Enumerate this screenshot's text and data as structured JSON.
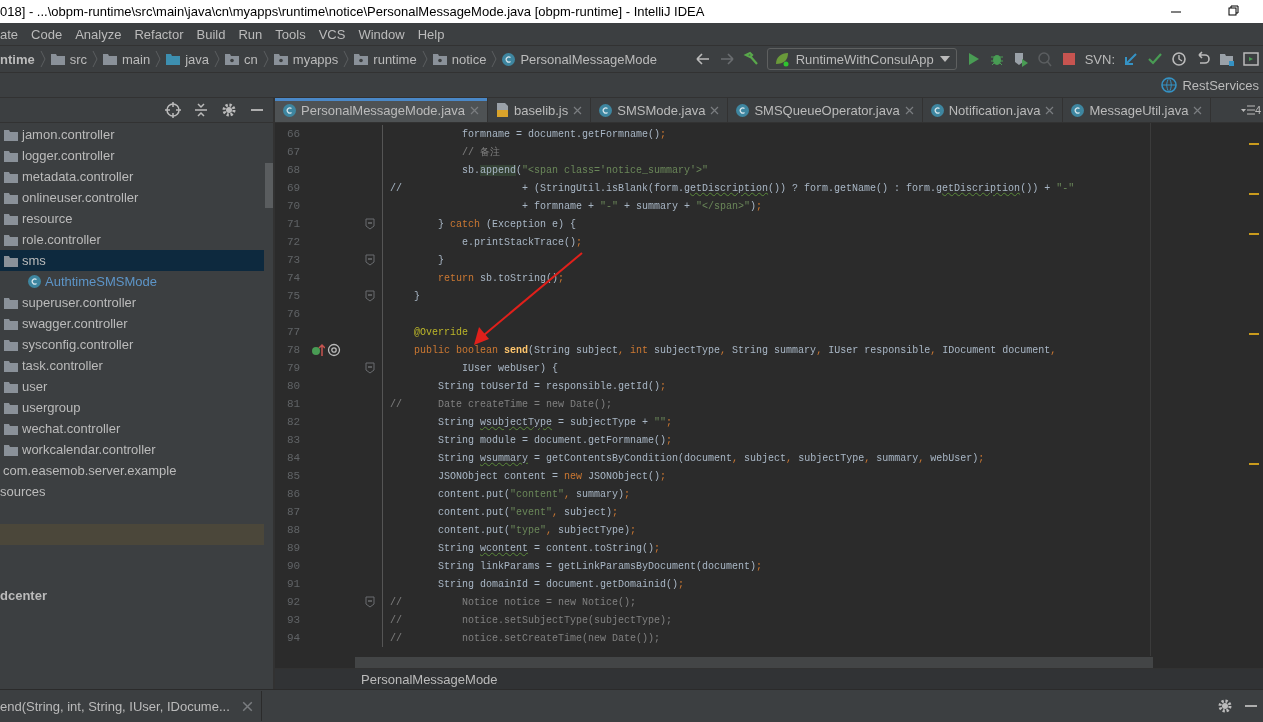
{
  "window": {
    "title": "018] - ...\\obpm-runtime\\src\\main\\java\\cn\\myapps\\runtime\\notice\\PersonalMessageMode.java [obpm-runtime] - IntelliJ IDEA"
  },
  "menu": [
    "ate",
    "Code",
    "Analyze",
    "Refactor",
    "Build",
    "Run",
    "Tools",
    "VCS",
    "Window",
    "Help"
  ],
  "breadcrumbs": [
    {
      "label": "ntime",
      "kind": "module"
    },
    {
      "label": "src",
      "kind": "folder"
    },
    {
      "label": "main",
      "kind": "folder"
    },
    {
      "label": "java",
      "kind": "source"
    },
    {
      "label": "cn",
      "kind": "package"
    },
    {
      "label": "myapps",
      "kind": "package"
    },
    {
      "label": "runtime",
      "kind": "package"
    },
    {
      "label": "notice",
      "kind": "package"
    },
    {
      "label": "PersonalMessageMode",
      "kind": "class"
    }
  ],
  "run_config": "RuntimeWithConsulApp",
  "svn_label": "SVN:",
  "rest_services": "RestServices",
  "tabs": [
    {
      "label": "PersonalMessageMode.java",
      "kind": "class",
      "selected": true
    },
    {
      "label": "baselib.js",
      "kind": "js",
      "selected": false
    },
    {
      "label": "SMSMode.java",
      "kind": "class",
      "selected": false
    },
    {
      "label": "SMSQueueOperator.java",
      "kind": "class",
      "selected": false
    },
    {
      "label": "Notification.java",
      "kind": "class",
      "selected": false
    },
    {
      "label": "MessageUtil.java",
      "kind": "class",
      "selected": false
    }
  ],
  "tabs_overflow": "4",
  "sidebar": {
    "items": [
      {
        "label": "jamon.controller",
        "kind": "folder",
        "selected": false
      },
      {
        "label": "logger.controller",
        "kind": "folder",
        "selected": false
      },
      {
        "label": "metadata.controller",
        "kind": "folder",
        "selected": false
      },
      {
        "label": "onlineuser.controller",
        "kind": "folder",
        "selected": false
      },
      {
        "label": "resource",
        "kind": "folder",
        "selected": false
      },
      {
        "label": "role.controller",
        "kind": "folder",
        "selected": false
      },
      {
        "label": "sms",
        "kind": "folder",
        "selected": true,
        "children": [
          {
            "label": "AuthtimeSMSMode",
            "kind": "class",
            "selected": false
          }
        ]
      },
      {
        "label": "superuser.controller",
        "kind": "folder",
        "selected": false
      },
      {
        "label": "swagger.controller",
        "kind": "folder",
        "selected": false
      },
      {
        "label": "sysconfig.controller",
        "kind": "folder",
        "selected": false
      },
      {
        "label": "task.controller",
        "kind": "folder",
        "selected": false
      },
      {
        "label": "user",
        "kind": "folder",
        "selected": false
      },
      {
        "label": "usergroup",
        "kind": "folder",
        "selected": false
      },
      {
        "label": "wechat.controller",
        "kind": "folder",
        "selected": false
      },
      {
        "label": "workcalendar.controller",
        "kind": "folder",
        "selected": false
      },
      {
        "label": "com.easemob.server.example",
        "kind": "package",
        "selected": false
      },
      {
        "label": "sources",
        "kind": "root",
        "selected": false
      }
    ],
    "bold_label": "dcenter"
  },
  "editor": {
    "lines": [
      {
        "n": "66",
        "fold": false,
        "tokens": [
          {
            "kind": "plain",
            "text": "            formname = document.getFormname()"
          },
          {
            "kind": "keyword",
            "text": ";"
          }
        ]
      },
      {
        "n": "67",
        "fold": false,
        "tokens": [
          {
            "kind": "comment",
            "text": "            // 备注"
          }
        ]
      },
      {
        "n": "68",
        "fold": false,
        "tokens": [
          {
            "kind": "plain",
            "text": "            sb."
          },
          {
            "kind": "highlight",
            "text": "append"
          },
          {
            "kind": "plain",
            "text": "("
          },
          {
            "kind": "string",
            "text": "\"<span class='notice_summary'>\""
          }
        ]
      },
      {
        "n": "69",
        "fold": false,
        "tokens": [
          {
            "kind": "plain",
            "text": "//                    + (StringUtil.isBlank(form."
          },
          {
            "kind": "warning",
            "text": "getDiscription"
          },
          {
            "kind": "plain",
            "text": "()) ? form.getName() : form."
          },
          {
            "kind": "warning",
            "text": "getDiscription"
          },
          {
            "kind": "plain",
            "text": "()) + "
          },
          {
            "kind": "string",
            "text": "\"-\""
          }
        ]
      },
      {
        "n": "70",
        "fold": false,
        "tokens": [
          {
            "kind": "plain",
            "text": "                      + formname + "
          },
          {
            "kind": "string",
            "text": "\"-\""
          },
          {
            "kind": "plain",
            "text": " + summary + "
          },
          {
            "kind": "string",
            "text": "\"</span>\""
          },
          {
            "kind": "plain",
            "text": ")"
          },
          {
            "kind": "keyword",
            "text": ";"
          }
        ]
      },
      {
        "n": "71",
        "fold": true,
        "tokens": [
          {
            "kind": "plain",
            "text": "        } "
          },
          {
            "kind": "keyword",
            "text": "catch"
          },
          {
            "kind": "plain",
            "text": " (Exception e) {"
          }
        ]
      },
      {
        "n": "72",
        "fold": false,
        "tokens": [
          {
            "kind": "plain",
            "text": "            e.printStackTrace()"
          },
          {
            "kind": "keyword",
            "text": ";"
          }
        ]
      },
      {
        "n": "73",
        "fold": true,
        "tokens": [
          {
            "kind": "plain",
            "text": "        }"
          }
        ]
      },
      {
        "n": "74",
        "fold": false,
        "tokens": [
          {
            "kind": "keyword",
            "text": "        return"
          },
          {
            "kind": "plain",
            "text": " sb.toString()"
          },
          {
            "kind": "keyword",
            "text": ";"
          }
        ]
      },
      {
        "n": "75",
        "fold": true,
        "tokens": [
          {
            "kind": "plain",
            "text": "    }"
          }
        ]
      },
      {
        "n": "76",
        "fold": false
      },
      {
        "n": "77",
        "fold": false,
        "tokens": [
          {
            "kind": "annotation",
            "text": "    @Override"
          }
        ]
      },
      {
        "n": "78",
        "fold": false,
        "override": true,
        "tokens": [
          {
            "kind": "keyword",
            "text": "    public boolean "
          },
          {
            "kind": "declaration",
            "text": "send"
          },
          {
            "kind": "plain",
            "text": "(String subject"
          },
          {
            "kind": "keyword",
            "text": ", int "
          },
          {
            "kind": "plain",
            "text": "subjectType"
          },
          {
            "kind": "keyword",
            "text": ", "
          },
          {
            "kind": "plain",
            "text": "String summary"
          },
          {
            "kind": "keyword",
            "text": ", "
          },
          {
            "kind": "plain",
            "text": "IUser responsible"
          },
          {
            "kind": "keyword",
            "text": ", "
          },
          {
            "kind": "plain",
            "text": "IDocument document"
          },
          {
            "kind": "keyword",
            "text": ","
          }
        ]
      },
      {
        "n": "79",
        "fold": true,
        "tokens": [
          {
            "kind": "plain",
            "text": "            IUser webUser) {"
          }
        ]
      },
      {
        "n": "80",
        "fold": false,
        "tokens": [
          {
            "kind": "plain",
            "text": "        String toUserId = responsible.getId()"
          },
          {
            "kind": "keyword",
            "text": ";"
          }
        ]
      },
      {
        "n": "81",
        "fold": false,
        "tokens": [
          {
            "kind": "comment",
            "text": "//      Date createTime = new Date();"
          }
        ]
      },
      {
        "n": "82",
        "fold": false,
        "tokens": [
          {
            "kind": "plain",
            "text": "        String "
          },
          {
            "kind": "warning",
            "text": "wsubjectType"
          },
          {
            "kind": "plain",
            "text": " = subjectType + "
          },
          {
            "kind": "string",
            "text": "\"\""
          },
          {
            "kind": "keyword",
            "text": ";"
          }
        ]
      },
      {
        "n": "83",
        "fold": false,
        "tokens": [
          {
            "kind": "plain",
            "text": "        String module = document.getFormname()"
          },
          {
            "kind": "keyword",
            "text": ";"
          }
        ]
      },
      {
        "n": "84",
        "fold": false,
        "tokens": [
          {
            "kind": "plain",
            "text": "        String "
          },
          {
            "kind": "warning",
            "text": "wsummary"
          },
          {
            "kind": "plain",
            "text": " = getContentsByCondition(document"
          },
          {
            "kind": "keyword",
            "text": ", "
          },
          {
            "kind": "plain",
            "text": "subject"
          },
          {
            "kind": "keyword",
            "text": ", "
          },
          {
            "kind": "plain",
            "text": "subjectType"
          },
          {
            "kind": "keyword",
            "text": ", "
          },
          {
            "kind": "plain",
            "text": "summary"
          },
          {
            "kind": "keyword",
            "text": ", "
          },
          {
            "kind": "plain",
            "text": "webUser)"
          },
          {
            "kind": "keyword",
            "text": ";"
          }
        ]
      },
      {
        "n": "85",
        "fold": false,
        "tokens": [
          {
            "kind": "plain",
            "text": "        JSONObject content = "
          },
          {
            "kind": "keyword",
            "text": "new "
          },
          {
            "kind": "plain",
            "text": "JSONObject()"
          },
          {
            "kind": "keyword",
            "text": ";"
          }
        ]
      },
      {
        "n": "86",
        "fold": false,
        "tokens": [
          {
            "kind": "plain",
            "text": "        content.put("
          },
          {
            "kind": "string",
            "text": "\"content\""
          },
          {
            "kind": "keyword",
            "text": ", "
          },
          {
            "kind": "plain",
            "text": "summary)"
          },
          {
            "kind": "keyword",
            "text": ";"
          }
        ]
      },
      {
        "n": "87",
        "fold": false,
        "tokens": [
          {
            "kind": "plain",
            "text": "        content.put("
          },
          {
            "kind": "string",
            "text": "\"event\""
          },
          {
            "kind": "keyword",
            "text": ", "
          },
          {
            "kind": "plain",
            "text": "subject)"
          },
          {
            "kind": "keyword",
            "text": ";"
          }
        ]
      },
      {
        "n": "88",
        "fold": false,
        "tokens": [
          {
            "kind": "plain",
            "text": "        content.put("
          },
          {
            "kind": "string",
            "text": "\"type\""
          },
          {
            "kind": "keyword",
            "text": ", "
          },
          {
            "kind": "plain",
            "text": "subjectType)"
          },
          {
            "kind": "keyword",
            "text": ";"
          }
        ]
      },
      {
        "n": "89",
        "fold": false,
        "tokens": [
          {
            "kind": "plain",
            "text": "        String "
          },
          {
            "kind": "warning",
            "text": "wcontent"
          },
          {
            "kind": "plain",
            "text": " = content.toString()"
          },
          {
            "kind": "keyword",
            "text": ";"
          }
        ]
      },
      {
        "n": "90",
        "fold": false,
        "tokens": [
          {
            "kind": "plain",
            "text": "        String linkParams = getLinkParamsByDocument(document)"
          },
          {
            "kind": "keyword",
            "text": ";"
          }
        ]
      },
      {
        "n": "91",
        "fold": false,
        "tokens": [
          {
            "kind": "plain",
            "text": "        String domainId = document.getDomainid()"
          },
          {
            "kind": "keyword",
            "text": ";"
          }
        ]
      },
      {
        "n": "92",
        "fold": true,
        "tokens": [
          {
            "kind": "comment",
            "text": "//          Notice notice = new Notice();"
          }
        ]
      },
      {
        "n": "93",
        "fold": false,
        "tokens": [
          {
            "kind": "comment",
            "text": "//          notice.setSubjectType(subjectType);"
          }
        ]
      },
      {
        "n": "94",
        "fold": false,
        "tokens": [
          {
            "kind": "comment",
            "text": "//          notice.setCreateTime(new Date());"
          }
        ]
      }
    ],
    "breadcrumb": "PersonalMessageMode"
  },
  "bottom_tab": "end(String, int, String, IUser, IDocume..."
}
